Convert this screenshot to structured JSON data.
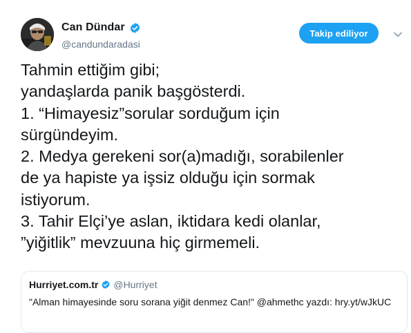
{
  "author": {
    "display_name": "Can Dündar",
    "handle": "@candundaradasi",
    "verified": true
  },
  "follow_button": {
    "label": "Takip ediliyor"
  },
  "tweet": {
    "lines": [
      "Tahmin ettiğim gibi;",
      "yandaşlarda panik başgösterdi.",
      "1. “Himayesiz”sorular sorduğum için",
      "sürgündeyim.",
      "2. Medya gerekeni sor(a)madığı, sorabilenler",
      "de ya hapiste ya işsiz olduğu için sormak",
      "istiyorum.",
      "3. Tahir Elçi’ye aslan, iktidara kedi olanlar,",
      "”yiğitlik” mevzuuna hiç girmemeli."
    ]
  },
  "quoted_tweet": {
    "display_name": "Hurriyet.com.tr",
    "handle": "@Hurriyet",
    "verified": true,
    "text": "\"Alman himayesinde soru sorana yiğit denmez Can!\" @ahmethc yazdı: hry.yt/wJkUC"
  },
  "icons": {
    "verified": "verified-badge-icon",
    "caret": "chevron-down-icon"
  },
  "colors": {
    "accent": "#1da1f2",
    "text": "#14171a",
    "secondary": "#657786",
    "border": "#e1e8ed"
  }
}
